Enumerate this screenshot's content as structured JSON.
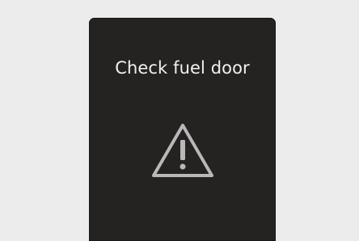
{
  "notification": {
    "message": "Check fuel door",
    "icon": "warning-triangle-icon"
  },
  "colors": {
    "background": "#ebeceb",
    "panel": "#252222",
    "text": "#f1f1f1",
    "icon": "#b8b8b8"
  }
}
